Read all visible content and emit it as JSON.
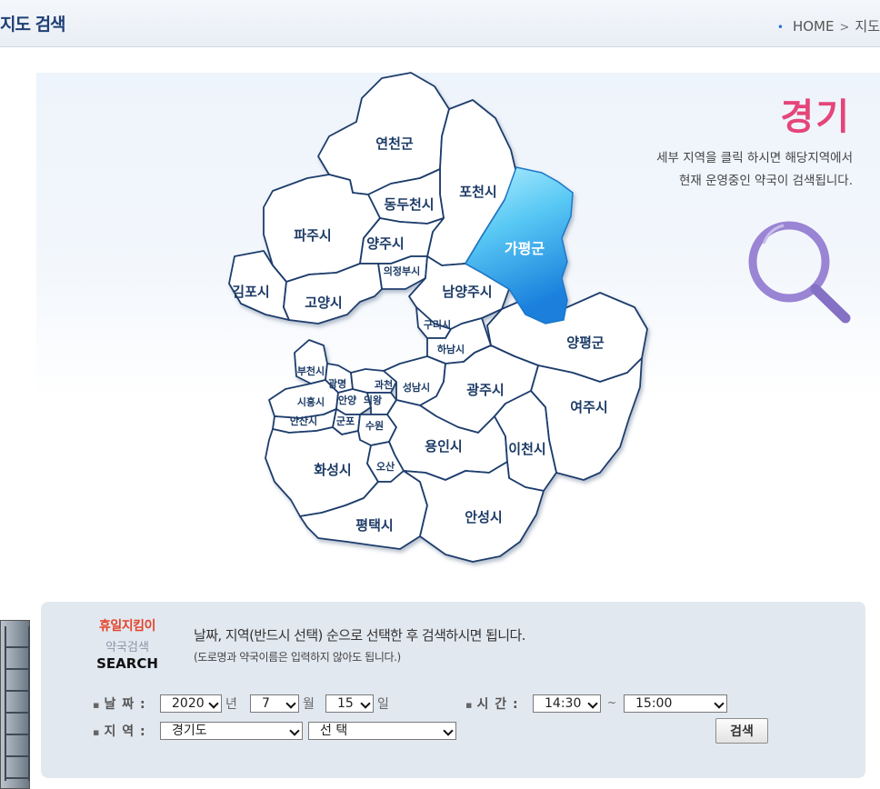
{
  "header": {
    "title": "지도 검색",
    "breadcrumb": {
      "home": "HOME",
      "separator": ">",
      "current": "지도"
    }
  },
  "region": {
    "title": "경기",
    "description_line1": "세부 지역을 클릭 하시면 해당지역에서",
    "description_line2": "현재 운영중인 약국이 검색됩니다."
  },
  "map": {
    "selected_region": "가평군",
    "regions": [
      "연천군",
      "포천시",
      "동두천시",
      "가평군",
      "파주시",
      "양주시",
      "의정부시",
      "김포시",
      "고양시",
      "남양주시",
      "구리시",
      "양평군",
      "하남시",
      "부천시",
      "광명",
      "과천",
      "성남시",
      "광주시",
      "시흥시",
      "안양",
      "의왕",
      "안산시",
      "군포",
      "수원",
      "여주시",
      "용인시",
      "이천시",
      "화성시",
      "오산",
      "평택시",
      "안성시"
    ]
  },
  "search": {
    "brand_line1": "휴일지킴이",
    "brand_line2": "약국검색",
    "brand_line3": "SEARCH",
    "guide_main": "날짜, 지역(반드시 선택) 순으로 선택한 후 검색하시면 됩니다.",
    "guide_sub": "(도로명과 약국이름은 입력하지 않아도 됩니다.)",
    "date_label": "날 짜 :",
    "year_value": "2020",
    "year_unit": "년",
    "month_value": "7",
    "month_unit": "월",
    "day_value": "15",
    "day_unit": "일",
    "time_label": "시 간 :",
    "time_start": "14:30",
    "time_separator": "~",
    "time_end": "15:00",
    "area_label": "지 역 :",
    "province_value": "경기도",
    "city_value": "선 택",
    "search_button": "검색"
  },
  "colors": {
    "accent_title": "#e5457a",
    "brand_red": "#e4452d",
    "selected_region_top": "#a9ebfb",
    "selected_region_bottom": "#1e86e0",
    "border_navy": "#1e3c6c"
  }
}
